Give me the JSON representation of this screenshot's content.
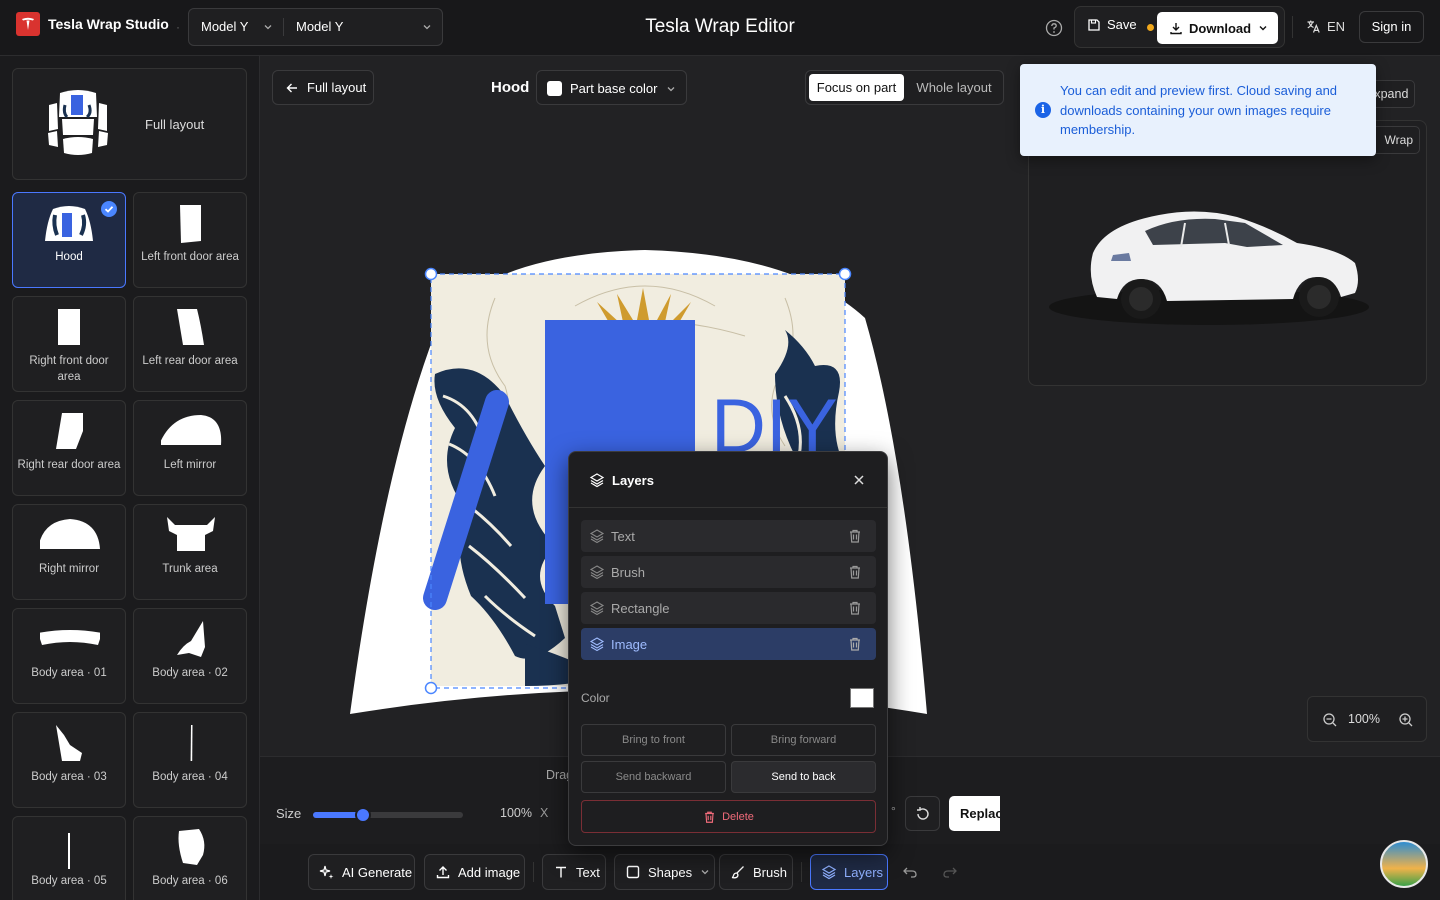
{
  "header": {
    "brand": "Tesla Wrap Studio",
    "brand_sep": "·",
    "model_primary": "Model Y",
    "model_secondary": "Model Y",
    "page_title": "Tesla Wrap Editor",
    "save_label": "Save",
    "download_label": "Download",
    "lang_label": "EN",
    "signin_label": "Sign in"
  },
  "sidebar": {
    "full_layout_label": "Full layout",
    "parts": [
      {
        "label": "Hood",
        "selected": true
      },
      {
        "label": "Left front door area"
      },
      {
        "label": "Right front door area"
      },
      {
        "label": "Left rear door area"
      },
      {
        "label": "Right rear door area"
      },
      {
        "label": "Left mirror"
      },
      {
        "label": "Right mirror"
      },
      {
        "label": "Trunk area"
      },
      {
        "label": "Body area · 01"
      },
      {
        "label": "Body area · 02"
      },
      {
        "label": "Body area · 03"
      },
      {
        "label": "Body area · 04"
      },
      {
        "label": "Body area · 05"
      },
      {
        "label": "Body area · 06"
      }
    ]
  },
  "canvas": {
    "back_label": "Full layout",
    "part_title": "Hood",
    "base_color_label": "Part base color",
    "view_focus": "Focus on part",
    "view_whole": "Whole layout",
    "expand_label": "Expand",
    "tour_label": "Wrap tour",
    "design_text": "DIY",
    "zoom_value": "100%",
    "toast": {
      "message": "You can edit and preview first. Cloud saving and downloads containing your own images require membership."
    }
  },
  "props": {
    "drag_hint": "Drag",
    "size_label": "Size",
    "size_pct": "100%",
    "size_fraction": 0.33,
    "x_label": "X",
    "deg_label": "°",
    "replace_label": "Replace"
  },
  "toolbar": {
    "ai_label": "AI Generate",
    "add_image_label": "Add image",
    "text_label": "Text",
    "shapes_label": "Shapes",
    "brush_label": "Brush",
    "layers_label": "Layers"
  },
  "layers_panel": {
    "title": "Layers",
    "items": [
      {
        "label": "Text"
      },
      {
        "label": "Brush"
      },
      {
        "label": "Rectangle"
      },
      {
        "label": "Image",
        "active": true
      }
    ],
    "color_label": "Color",
    "bring_front": "Bring to front",
    "bring_forward": "Bring forward",
    "send_backward": "Send backward",
    "send_back": "Send to back",
    "delete_label": "Delete"
  },
  "colors": {
    "accent": "#4a78ff",
    "rect_blue": "#3a63e0",
    "cream": "#f1ede0",
    "navy": "#1a3150"
  }
}
